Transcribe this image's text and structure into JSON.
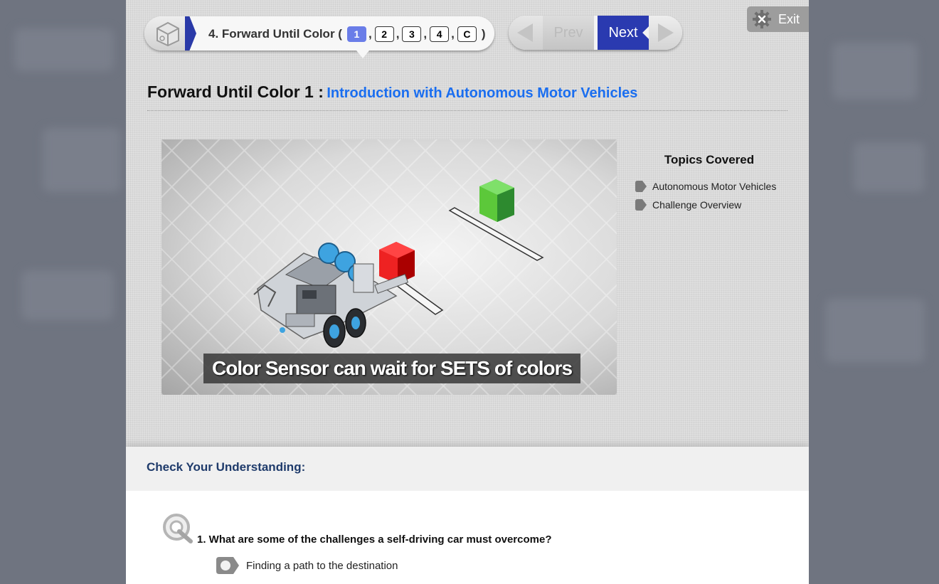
{
  "breadcrumb": {
    "home_icon": "cube-icon",
    "lesson_label": "4. Forward Until Color (",
    "pages": [
      "1",
      "2",
      "3",
      "4",
      "C"
    ],
    "separator": ",",
    "close_paren": ")",
    "active_page": "1"
  },
  "nav": {
    "prev_label": "Prev",
    "next_label": "Next",
    "exit_label": "Exit"
  },
  "header": {
    "title": "Forward Until Color 1 :",
    "subtitle": "Introduction with Autonomous Motor Vehicles"
  },
  "video": {
    "caption": "Color Sensor can wait  for SETS of colors"
  },
  "topics": {
    "title": "Topics Covered",
    "items": [
      "Autonomous Motor Vehicles",
      "Challenge Overview"
    ]
  },
  "quiz": {
    "section_title": "Check Your Understanding:",
    "question": "1. What are some of the challenges a self-driving car must overcome?",
    "answer_1": "Finding a path to the destination"
  },
  "colors": {
    "accent_blue": "#2a3ab0",
    "link_blue": "#1a6ef0",
    "active_page": "#6a7de8"
  }
}
